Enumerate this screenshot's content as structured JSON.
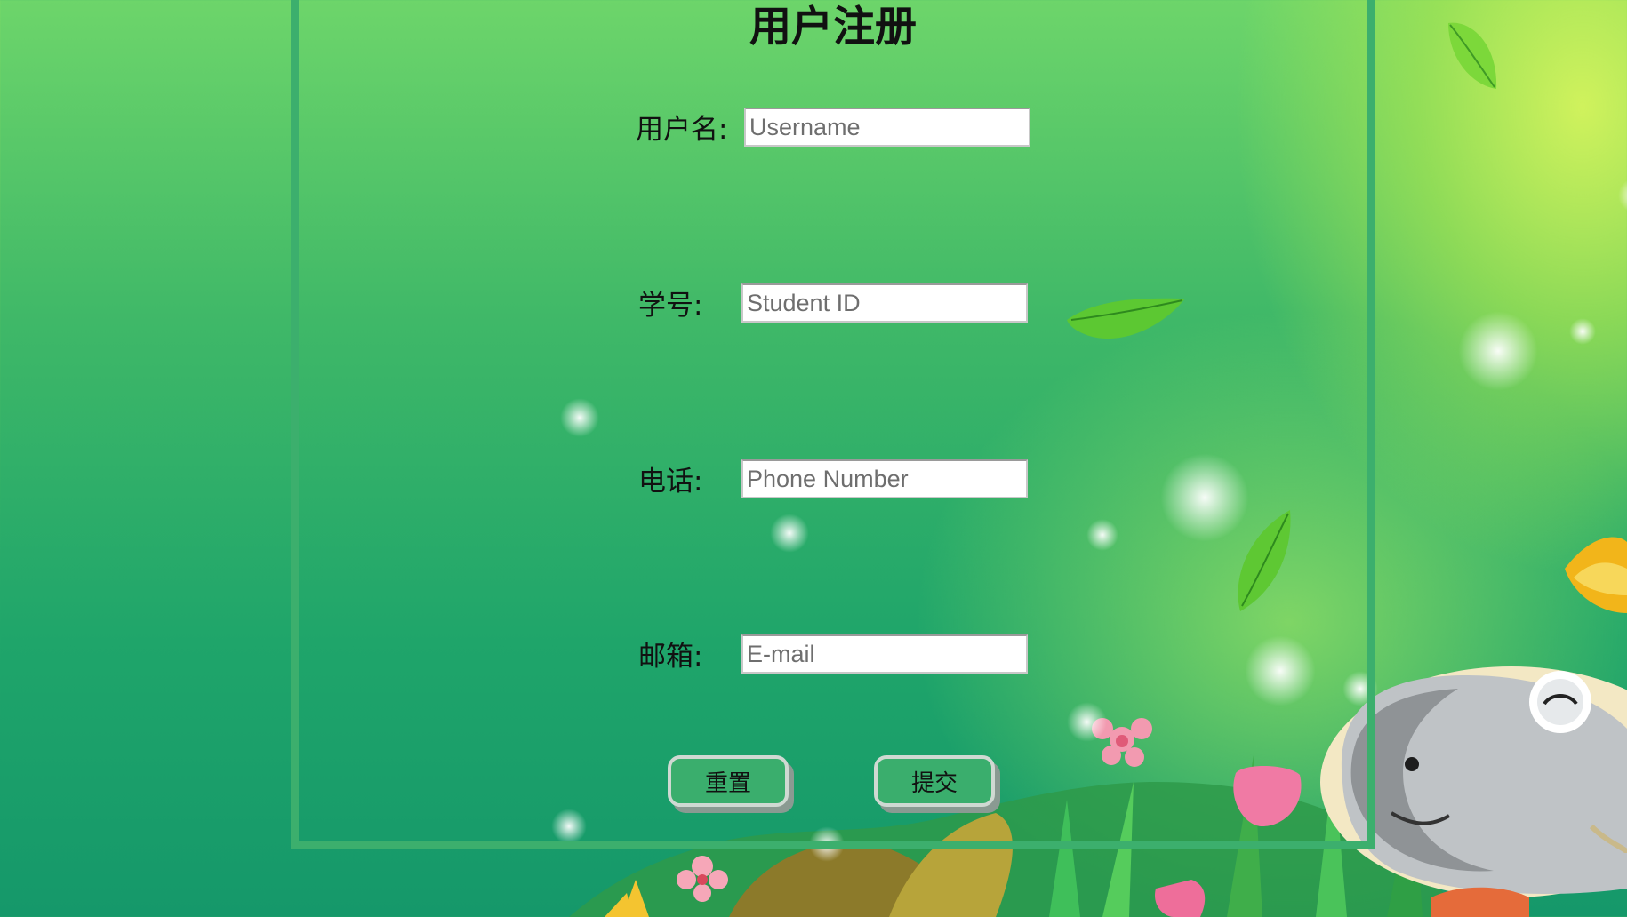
{
  "form": {
    "title": "用户注册",
    "fields": [
      {
        "label": "用户名:",
        "placeholder": "Username"
      },
      {
        "label": "学号:",
        "placeholder": "Student ID"
      },
      {
        "label": "电话:",
        "placeholder": "Phone Number"
      },
      {
        "label": "邮箱:",
        "placeholder": "E-mail"
      }
    ],
    "buttons": {
      "reset": "重置",
      "submit": "提交"
    }
  },
  "colors": {
    "background_top": "#6dd56a",
    "background_bottom": "#15986a",
    "frame_border": "#3caf6d",
    "button_fill": "#3aae6d"
  }
}
